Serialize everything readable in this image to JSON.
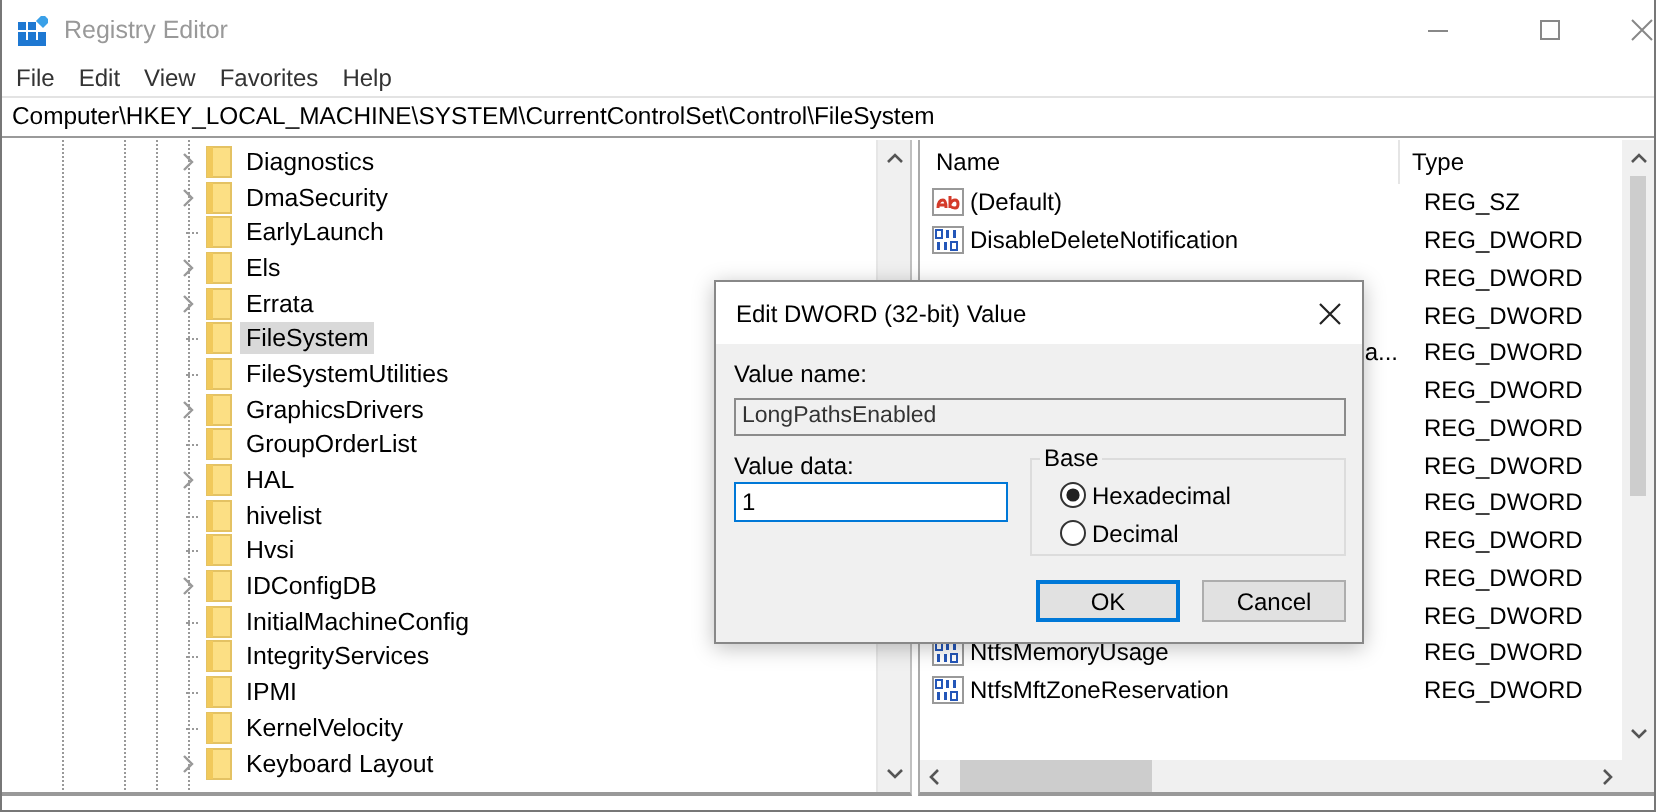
{
  "window": {
    "title": "Registry Editor"
  },
  "menu": [
    "File",
    "Edit",
    "View",
    "Favorites",
    "Help"
  ],
  "address": "Computer\\HKEY_LOCAL_MACHINE\\SYSTEM\\CurrentControlSet\\Control\\FileSystem",
  "tree": {
    "items": [
      {
        "label": "Diagnostics",
        "expandable": true,
        "selected": false
      },
      {
        "label": "DmaSecurity",
        "expandable": true,
        "selected": false
      },
      {
        "label": "EarlyLaunch",
        "expandable": false,
        "selected": false
      },
      {
        "label": "Els",
        "expandable": true,
        "selected": false
      },
      {
        "label": "Errata",
        "expandable": true,
        "selected": false
      },
      {
        "label": "FileSystem",
        "expandable": false,
        "selected": true
      },
      {
        "label": "FileSystemUtilities",
        "expandable": false,
        "selected": false
      },
      {
        "label": "GraphicsDrivers",
        "expandable": true,
        "selected": false
      },
      {
        "label": "GroupOrderList",
        "expandable": false,
        "selected": false
      },
      {
        "label": "HAL",
        "expandable": true,
        "selected": false
      },
      {
        "label": "hivelist",
        "expandable": false,
        "selected": false
      },
      {
        "label": "Hvsi",
        "expandable": false,
        "selected": false
      },
      {
        "label": "IDConfigDB",
        "expandable": true,
        "selected": false
      },
      {
        "label": "InitialMachineConfig",
        "expandable": false,
        "selected": false
      },
      {
        "label": "IntegrityServices",
        "expandable": false,
        "selected": false
      },
      {
        "label": "IPMI",
        "expandable": false,
        "selected": false
      },
      {
        "label": "KernelVelocity",
        "expandable": false,
        "selected": false
      },
      {
        "label": "Keyboard Layout",
        "expandable": true,
        "selected": false
      }
    ]
  },
  "values": {
    "columns": [
      "Name",
      "Type"
    ],
    "rows": [
      {
        "kind": "string",
        "name": "(Default)",
        "type": "REG_SZ"
      },
      {
        "kind": "dword",
        "name": "DisableDeleteNotification",
        "type": "REG_DWORD"
      },
      {
        "type": "REG_DWORD"
      },
      {
        "type": "REG_DWORD"
      },
      {
        "name": "a...",
        "tail_only": true,
        "type": "REG_DWORD"
      },
      {
        "type": "REG_DWORD"
      },
      {
        "type": "REG_DWORD"
      },
      {
        "type": "REG_DWORD"
      },
      {
        "type": "REG_DWORD"
      },
      {
        "type": "REG_DWORD"
      },
      {
        "type": "REG_DWORD"
      },
      {
        "type": "REG_DWORD"
      },
      {
        "kind": "dword",
        "name": "NtfsMemoryUsage",
        "type": "REG_DWORD"
      },
      {
        "kind": "dword",
        "name": "NtfsMftZoneReservation",
        "type": "REG_DWORD"
      }
    ]
  },
  "dialog": {
    "title": "Edit DWORD (32-bit) Value",
    "value_name_label": "Value name:",
    "value_name": "LongPathsEnabled",
    "value_data_label": "Value data:",
    "value_data": "1",
    "base_label": "Base",
    "radios": [
      {
        "label": "Hexadecimal",
        "selected": true
      },
      {
        "label": "Decimal",
        "selected": false
      }
    ],
    "buttons": [
      {
        "label": "OK",
        "default": true
      },
      {
        "label": "Cancel",
        "default": false
      }
    ]
  }
}
